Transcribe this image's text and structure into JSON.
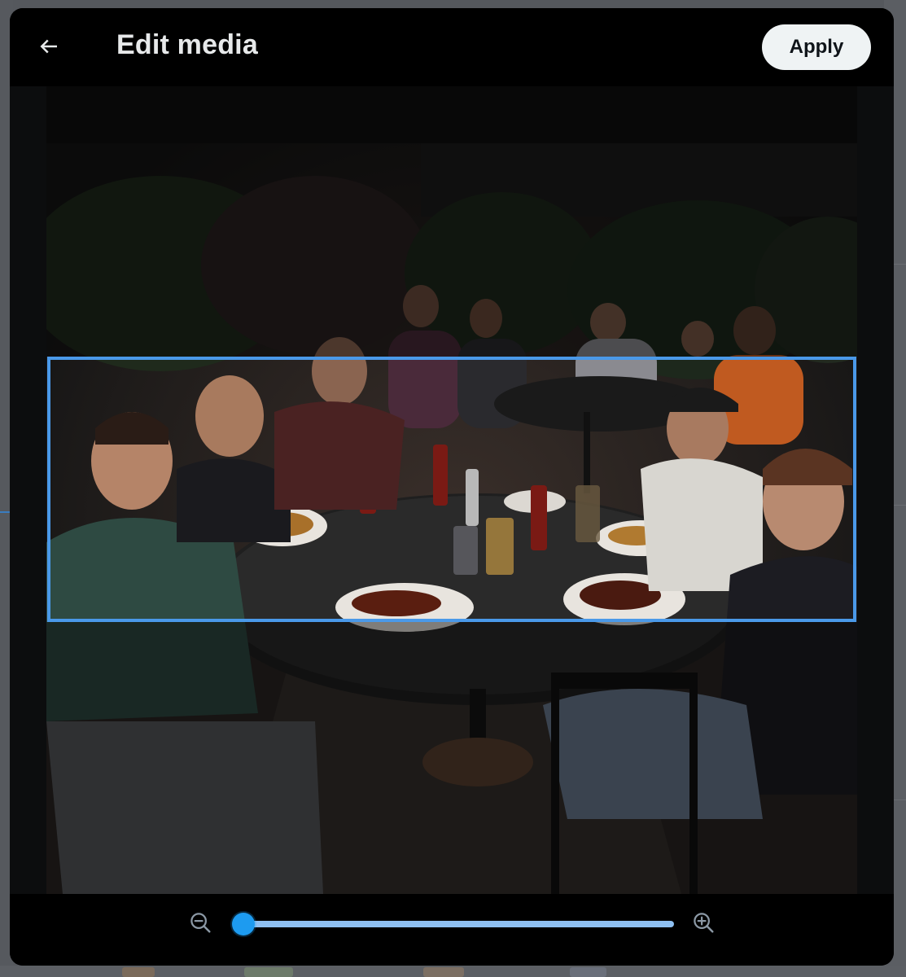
{
  "header": {
    "title": "Edit media",
    "apply_label": "Apply",
    "back_icon": "arrow-left-icon"
  },
  "editor": {
    "photo_description_icon": "group-dinner-photo",
    "crop_accent_color": "#4a99e9"
  },
  "footer": {
    "zoom_out_icon": "zoom-out-icon",
    "zoom_in_icon": "zoom-in-icon",
    "zoom_level": 0.02,
    "slider_color": "#1d9bf0"
  }
}
